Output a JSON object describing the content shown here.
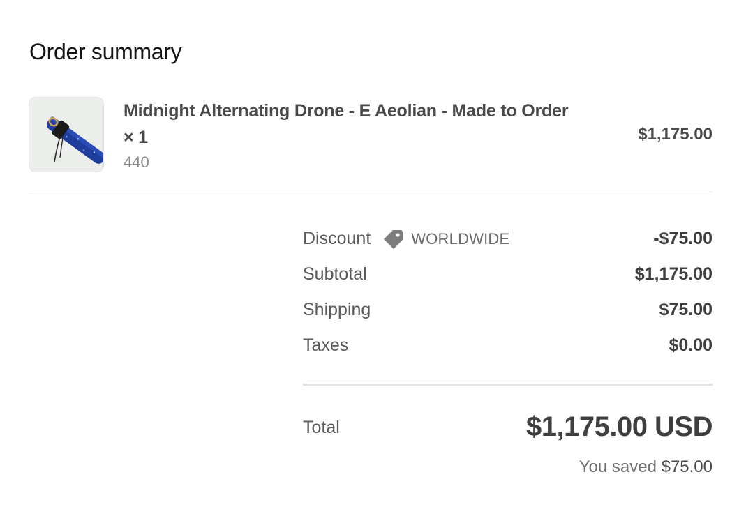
{
  "header": {
    "title": "Order summary"
  },
  "line_item": {
    "image_icon": "product-flute-thumbnail",
    "title": "Midnight Alternating Drone - E Aeolian - Made to Order × 1",
    "variant": "440",
    "price": "$1,175.00"
  },
  "costs": {
    "discount": {
      "label": "Discount",
      "icon": "tag-icon",
      "code": "WORLDWIDE",
      "value": "-$75.00"
    },
    "subtotal": {
      "label": "Subtotal",
      "value": "$1,175.00"
    },
    "shipping": {
      "label": "Shipping",
      "value": "$75.00"
    },
    "taxes": {
      "label": "Taxes",
      "value": "$0.00"
    }
  },
  "total": {
    "label": "Total",
    "value": "$1,175.00 USD",
    "savings_prefix": "You saved",
    "savings_amount": "$75.00"
  },
  "colors": {
    "thumb_bg": "#eceeec",
    "flute_blue": "#1f3d9a",
    "tag_gray": "#7d7d7d"
  }
}
